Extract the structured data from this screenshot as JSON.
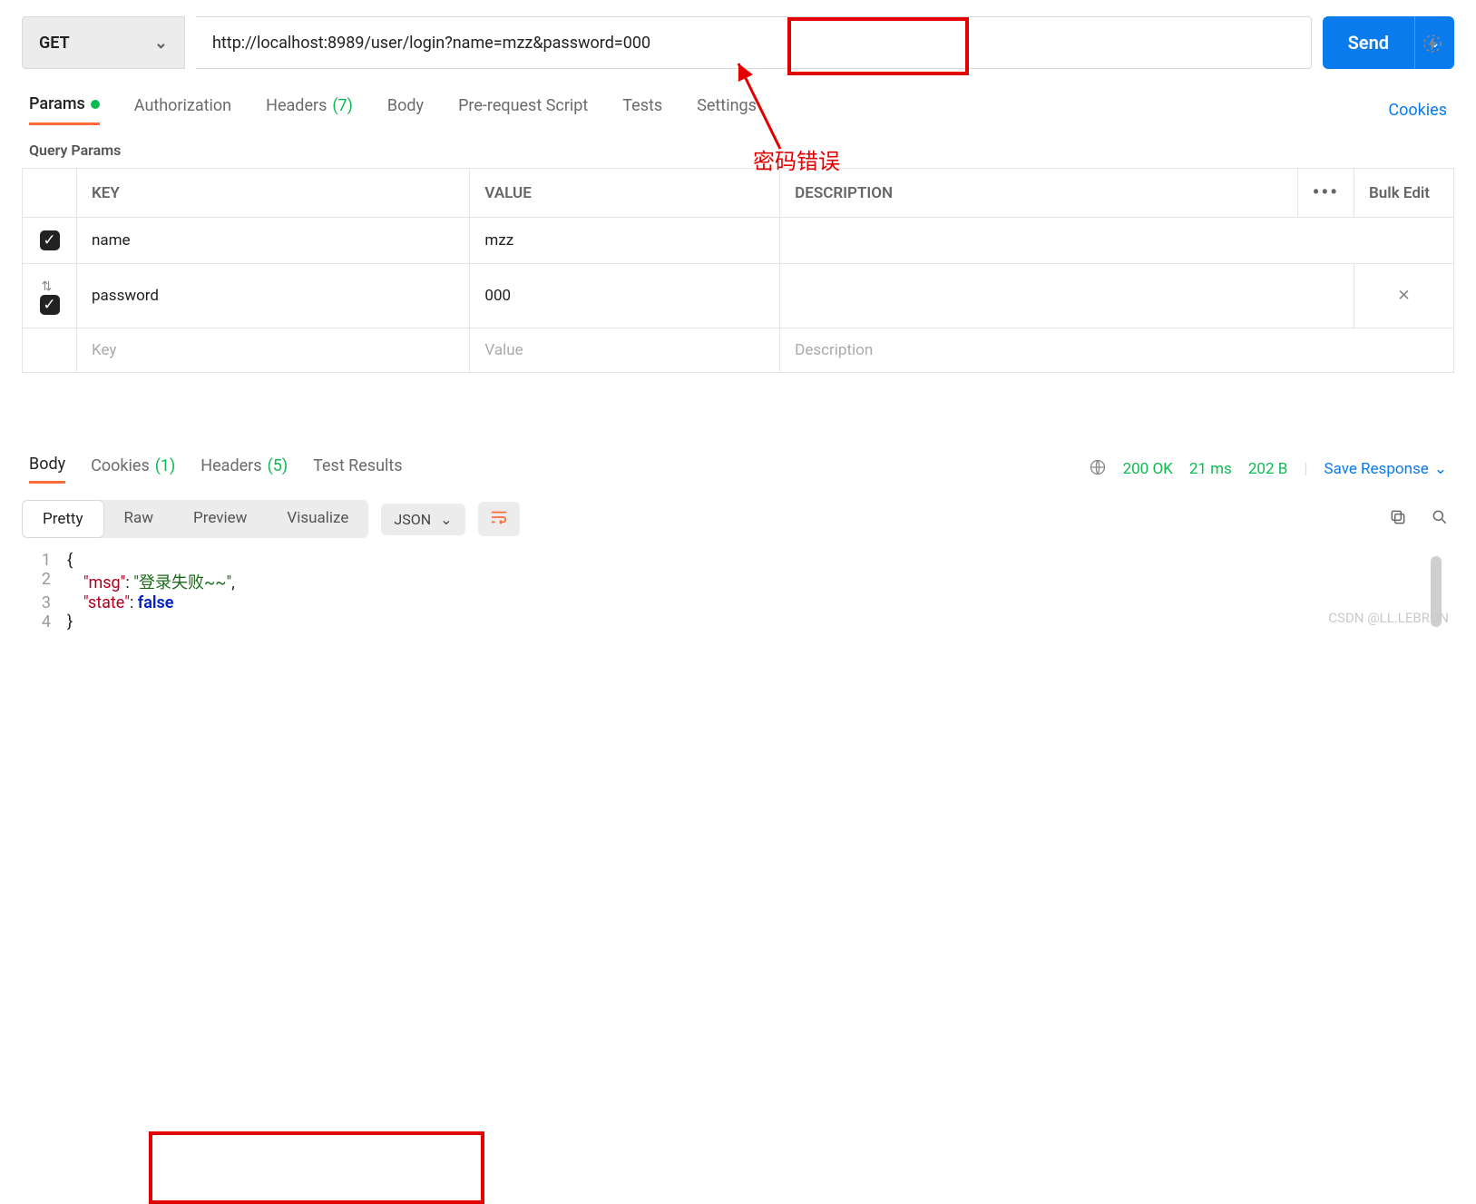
{
  "request": {
    "method": "GET",
    "url": "http://localhost:8989/user/login?name=mzz&password=000",
    "send_label": "Send"
  },
  "tabs": {
    "params": "Params",
    "authorization": "Authorization",
    "headers": "Headers",
    "headers_count": "(7)",
    "body": "Body",
    "prerequest": "Pre-request Script",
    "tests": "Tests",
    "settings": "Settings",
    "cookies": "Cookies"
  },
  "query_params": {
    "title": "Query Params",
    "columns": {
      "key": "KEY",
      "value": "VALUE",
      "description": "DESCRIPTION"
    },
    "bulk_edit": "Bulk Edit",
    "rows": [
      {
        "key": "name",
        "value": "mzz",
        "description": ""
      },
      {
        "key": "password",
        "value": "000",
        "description": ""
      }
    ],
    "placeholders": {
      "key": "Key",
      "value": "Value",
      "description": "Description"
    }
  },
  "response": {
    "tabs": {
      "body": "Body",
      "cookies": "Cookies",
      "cookies_count": "(1)",
      "headers": "Headers",
      "headers_count": "(5)",
      "test_results": "Test Results"
    },
    "status": "200 OK",
    "time": "21 ms",
    "size": "202 B",
    "save": "Save Response",
    "view": {
      "pretty": "Pretty",
      "raw": "Raw",
      "preview": "Preview",
      "visualize": "Visualize",
      "format": "JSON"
    },
    "json_body": {
      "msg_key": "\"msg\"",
      "msg_val": "\"登录失败~~\"",
      "state_key": "\"state\"",
      "state_val": "false"
    },
    "line_numbers": [
      "1",
      "2",
      "3",
      "4"
    ]
  },
  "annotation": "密码错误",
  "watermark": "CSDN @LL.LEBRON"
}
